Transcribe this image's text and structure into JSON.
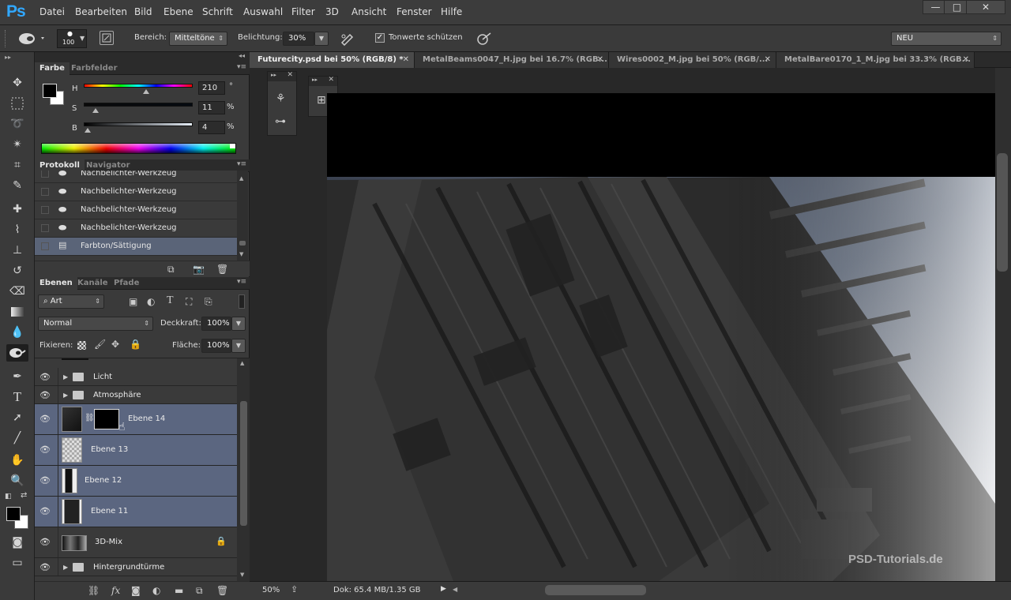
{
  "app": {
    "logo": "Ps"
  },
  "menu": [
    "Datei",
    "Bearbeiten",
    "Bild",
    "Ebene",
    "Schrift",
    "Auswahl",
    "Filter",
    "3D",
    "Ansicht",
    "Fenster",
    "Hilfe"
  ],
  "window_controls": {
    "minimize": "—",
    "maximize": "□",
    "close": "✕"
  },
  "options": {
    "brush_size": "100",
    "bereich_label": "Bereich:",
    "bereich_value": "Mitteltöne",
    "belichtung_label": "Belichtung:",
    "belichtung_value": "30%",
    "tonwerte_label": "Tonwerte schützen",
    "tonwerte_checked": "✓",
    "workspace": "NEU"
  },
  "color_panel": {
    "tabs": [
      "Farbe",
      "Farbfelder"
    ],
    "h_label": "H",
    "h_value": "210",
    "h_unit": "°",
    "s_label": "S",
    "s_value": "11",
    "s_unit": "%",
    "b_label": "B",
    "b_value": "4",
    "b_unit": "%"
  },
  "history_panel": {
    "tabs": [
      "Protokoll",
      "Navigator"
    ],
    "items": [
      {
        "label": "Nachbelichter-Werkzeug"
      },
      {
        "label": "Nachbelichter-Werkzeug"
      },
      {
        "label": "Nachbelichter-Werkzeug"
      },
      {
        "label": "Nachbelichter-Werkzeug"
      },
      {
        "label": "Farbton/Sättigung"
      }
    ]
  },
  "layers_panel": {
    "tabs": [
      "Ebenen",
      "Kanäle",
      "Pfade"
    ],
    "filter_label": "Art",
    "blend_mode": "Normal",
    "opacity_label": "Deckkraft:",
    "opacity_value": "100%",
    "lock_label": "Fixieren:",
    "fill_label": "Fläche:",
    "fill_value": "100%",
    "layers": [
      {
        "name": "Licht",
        "type": "group"
      },
      {
        "name": "Atmosphäre",
        "type": "group"
      },
      {
        "name": "Ebene 14",
        "type": "mask"
      },
      {
        "name": "Ebene 13",
        "type": "layer"
      },
      {
        "name": "Ebene 12",
        "type": "layer"
      },
      {
        "name": "Ebene 11",
        "type": "layer"
      },
      {
        "name": "3D-Mix",
        "type": "locked"
      },
      {
        "name": "Hintergrundtürme",
        "type": "group"
      }
    ]
  },
  "doc_tabs": [
    {
      "label": "Futurecity.psd bei 50% (RGB/8) *",
      "active": true
    },
    {
      "label": "MetalBeams0047_H.jpg bei 16.7% (RGB...",
      "active": false
    },
    {
      "label": "Wires0002_M.jpg bei 50% (RGB/...",
      "active": false
    },
    {
      "label": "MetalBare0170_1_M.jpg bei 33.3% (RGB...",
      "active": false
    }
  ],
  "status": {
    "zoom": "50%",
    "doc": "Dok: 65.4 MB/1.35 GB"
  },
  "watermark": "PSD-Tutorials.de",
  "colors": {
    "accent": "#31a8ff",
    "selection": "#5b6680"
  }
}
